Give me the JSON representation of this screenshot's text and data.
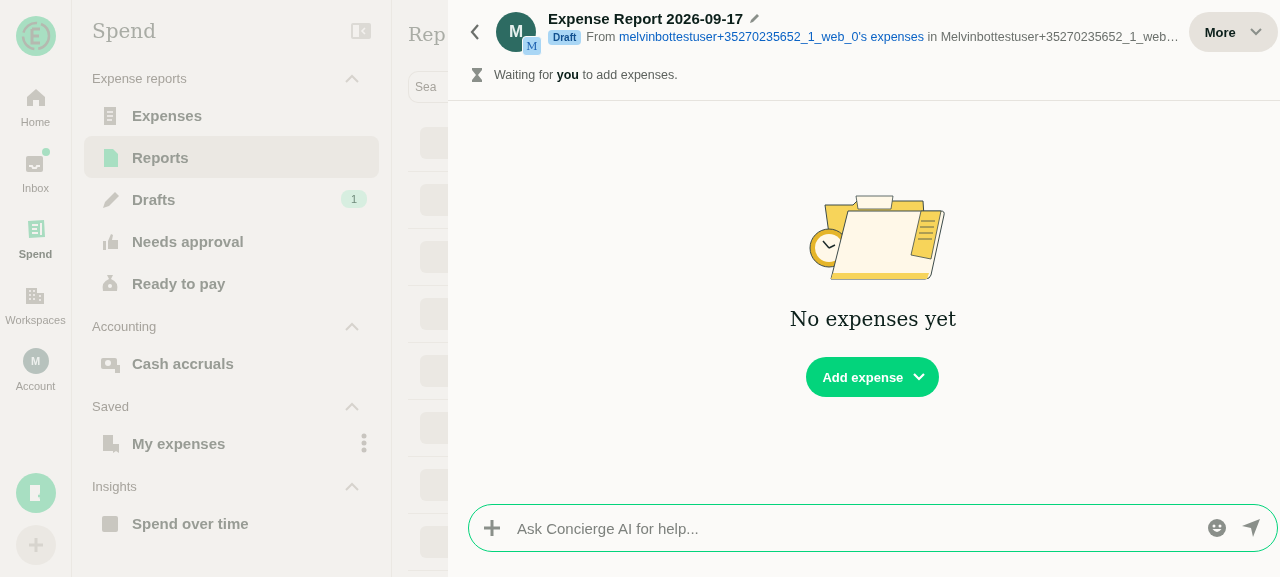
{
  "rail": {
    "items": [
      {
        "label": "Home",
        "selected": false,
        "dot": false
      },
      {
        "label": "Inbox",
        "selected": false,
        "dot": true
      },
      {
        "label": "Spend",
        "selected": true,
        "dot": false
      },
      {
        "label": "Workspaces",
        "selected": false,
        "dot": false
      },
      {
        "avatar": "M",
        "label": "Account",
        "selected": false,
        "dot": false
      }
    ]
  },
  "sidebar": {
    "title": "Spend",
    "sections": [
      {
        "title": "Expense reports",
        "expanded": true,
        "items": [
          {
            "label": "Expenses",
            "selected": false
          },
          {
            "label": "Reports",
            "selected": true
          },
          {
            "label": "Drafts",
            "selected": false,
            "badge": "1"
          },
          {
            "label": "Needs approval",
            "selected": false
          },
          {
            "label": "Ready to pay",
            "selected": false
          }
        ]
      },
      {
        "title": "Accounting",
        "expanded": true,
        "items": [
          {
            "label": "Cash accruals",
            "selected": false
          }
        ]
      },
      {
        "title": "Saved",
        "expanded": true,
        "items": [
          {
            "label": "My expenses",
            "selected": false,
            "menu": true
          }
        ]
      },
      {
        "title": "Insights",
        "expanded": true,
        "items": [
          {
            "label": "Spend over time",
            "selected": false
          }
        ]
      }
    ]
  },
  "middle": {
    "title": "Rep",
    "search": {
      "placeholder": "Sea"
    }
  },
  "report": {
    "title": "Expense Report 2026-09-17",
    "avatar": "M",
    "workspace_avatar": "M",
    "status": "Draft",
    "from_prefix": "From",
    "owner_link": "melvinbottestuser+35270235652_1_web_0's expenses",
    "in_text": "in Melvinbottestuser+35270235652_1_web…",
    "more_button": "More",
    "waiting": "Waiting for **you** to add expenses.",
    "empty_title": "No expenses yet",
    "add_button": "Add expense",
    "composer": {
      "placeholder": "Ask Concierge AI for help..."
    }
  }
}
